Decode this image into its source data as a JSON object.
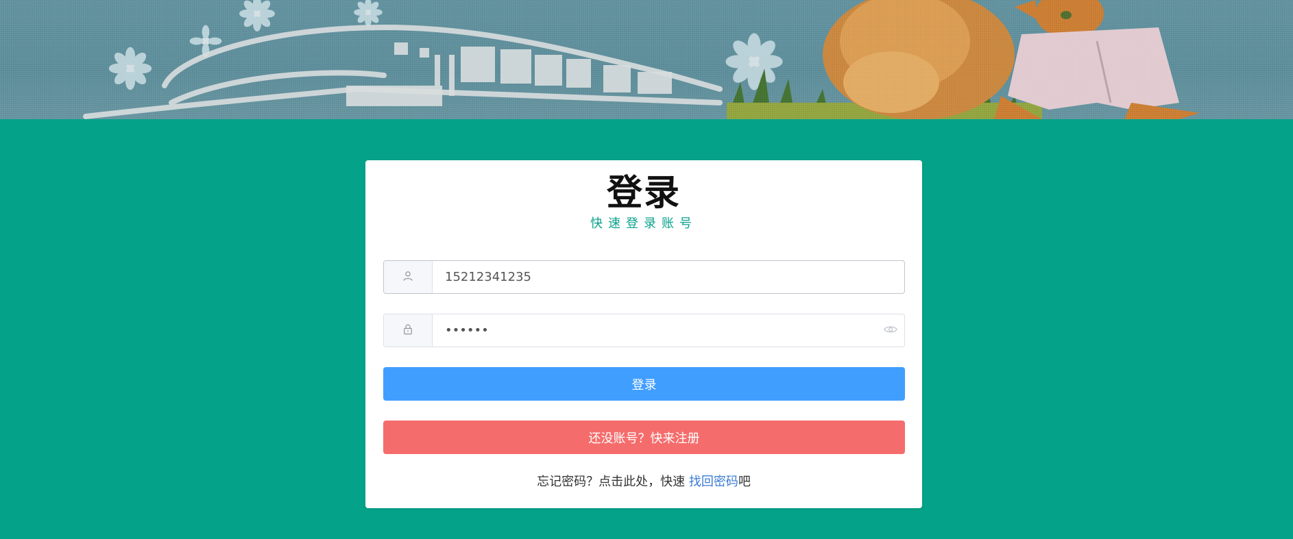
{
  "banner": {
    "description_icon": "train-and-cat-banner"
  },
  "card": {
    "title": "登录",
    "subtitle": "快速登录账号"
  },
  "form": {
    "username": {
      "icon": "user-icon",
      "value": "15212341235"
    },
    "password": {
      "icon": "lock-icon",
      "value": "••••••",
      "toggle_icon": "eye-icon"
    }
  },
  "buttons": {
    "login_label": "登录",
    "register_label": "还没账号？快来注册"
  },
  "forgot": {
    "prefix": "忘记密码？点击此处，快速 ",
    "link": "找回密码",
    "suffix": "吧"
  },
  "colors": {
    "page_bg": "#04a288",
    "login_button": "#409eff",
    "register_button": "#f56c6c",
    "subtitle": "#0aa28c",
    "link": "#3a7bd5"
  }
}
